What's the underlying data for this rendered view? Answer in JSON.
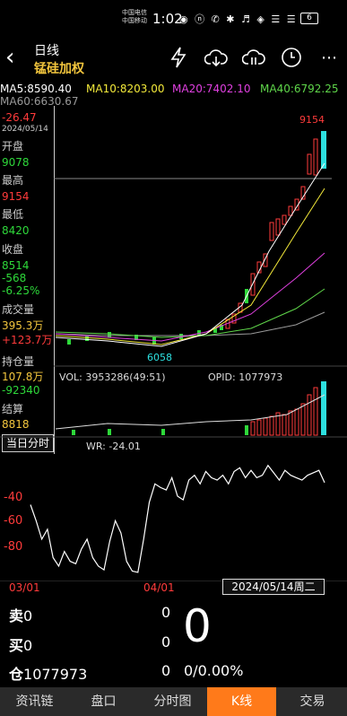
{
  "status_bar": {
    "carrier1": "中国电信",
    "carrier2": "中国移动",
    "time": "1:02",
    "battery": "6"
  },
  "header": {
    "title": "日线",
    "subtitle": "锰硅加权"
  },
  "ma": {
    "ma5": "MA5:8590.40",
    "ma10": "MA10:8203.00",
    "ma20": "MA20:7402.10",
    "ma40": "MA40:6792.25",
    "ma60": "MA60:6630.67",
    "colors": {
      "ma5": "#ffffff",
      "ma10": "#f3e93a",
      "ma20": "#e040e0",
      "ma40": "#5fd64a",
      "ma60": "#9a9a9a"
    }
  },
  "sidebar": {
    "change_top": "-26.47",
    "date": "2024/05/14",
    "open_label": "开盘",
    "open": "9078",
    "high_label": "最高",
    "high": "9154",
    "low_label": "最低",
    "low": "8420",
    "close_label": "收盘",
    "close": "8514",
    "change": "-568",
    "change_pct": "-6.25%",
    "volume_label": "成交量",
    "volume": "395.3万",
    "volume_change": "+123.7万",
    "oi_label": "持仓量",
    "oi": "107.8万",
    "oi_change": "-92340",
    "settle_label": "结算",
    "settle": "8818",
    "intraday_button": "当日分时"
  },
  "chart": {
    "high_marker": "9154",
    "low_marker": "6058",
    "vol_label": "VOL: 3953286(49:51)",
    "opid_label": "OPID: 1077973",
    "wr_label": "WR: -24.01",
    "wr_ticks": [
      "-40",
      "-60",
      "-80"
    ],
    "date_left": "03/01",
    "date_mid": "04/01",
    "date_box": "2024/05/14周二"
  },
  "chart_data": {
    "type": "line",
    "title": "",
    "xlabel": "",
    "ylabel": "WR",
    "ylim": [
      -100,
      0
    ],
    "x": [
      1,
      2,
      3,
      4,
      5,
      6,
      7,
      8,
      9,
      10,
      11,
      12,
      13,
      14,
      15,
      16,
      17,
      18,
      19,
      20,
      21,
      22,
      23,
      24,
      25,
      26,
      27,
      28,
      29,
      30,
      31,
      32,
      33,
      34,
      35,
      36,
      37,
      38,
      39,
      40,
      41,
      42,
      43,
      44,
      45,
      46,
      47,
      48,
      49,
      50,
      51,
      52,
      53
    ],
    "series": [
      {
        "name": "WR",
        "values": [
          -42,
          -55,
          -70,
          -62,
          -85,
          -92,
          -80,
          -88,
          -90,
          -78,
          -70,
          -85,
          -92,
          -95,
          -72,
          -55,
          -65,
          -88,
          -96,
          -97,
          -70,
          -40,
          -25,
          -28,
          -30,
          -20,
          -35,
          -38,
          -22,
          -18,
          -25,
          -15,
          -20,
          -22,
          -18,
          -25,
          -15,
          -12,
          -20,
          -14,
          -20,
          -18,
          -10,
          -16,
          -22,
          -14,
          -18,
          -20,
          -22,
          -18,
          -16,
          -14,
          -24
        ]
      }
    ]
  },
  "orderbook": {
    "sell_label": "卖",
    "sell_price": "0",
    "sell_qty": "0",
    "buy_label": "买",
    "buy_price": "0",
    "buy_qty": "0",
    "pos_label": "仓",
    "pos_value": "1077973",
    "pos_qty": "0",
    "big_number": "0",
    "ratio": "0/0.00%"
  },
  "nav": {
    "tab1": "资讯链",
    "tab2": "盘口",
    "tab3": "分时图",
    "tab4": "K线",
    "tab5": "交易"
  }
}
